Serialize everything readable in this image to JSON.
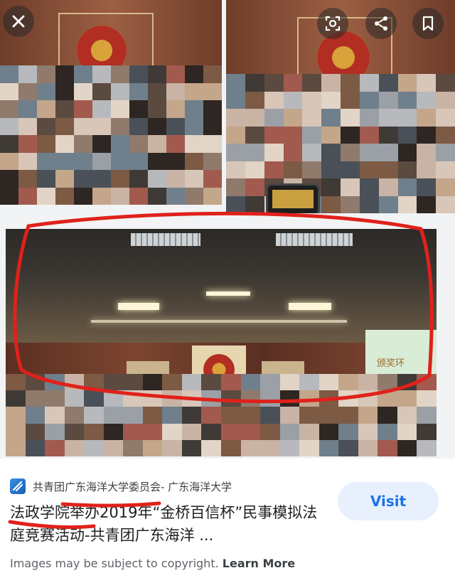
{
  "viewer": {
    "close_icon": "close-icon",
    "lens_icon": "lens-icon",
    "share_icon": "share-icon",
    "bookmark_icon": "bookmark-icon",
    "screen_text": "颁奖环"
  },
  "result": {
    "site": "共青团广东海洋大学委员会- 广东海洋大学",
    "title": "法政学院举办2019年“金桥百信杯”民事模拟法庭竞赛活动-共青团广东海洋 ...",
    "visit_label": "Visit"
  },
  "footer": {
    "copyright_prefix": "Images may be subject to copyright.",
    "learn_more": "Learn More"
  },
  "colors": {
    "annotation_red": "#e0211b",
    "visit_bg": "#e8f0fe",
    "visit_text": "#1a73e8"
  }
}
